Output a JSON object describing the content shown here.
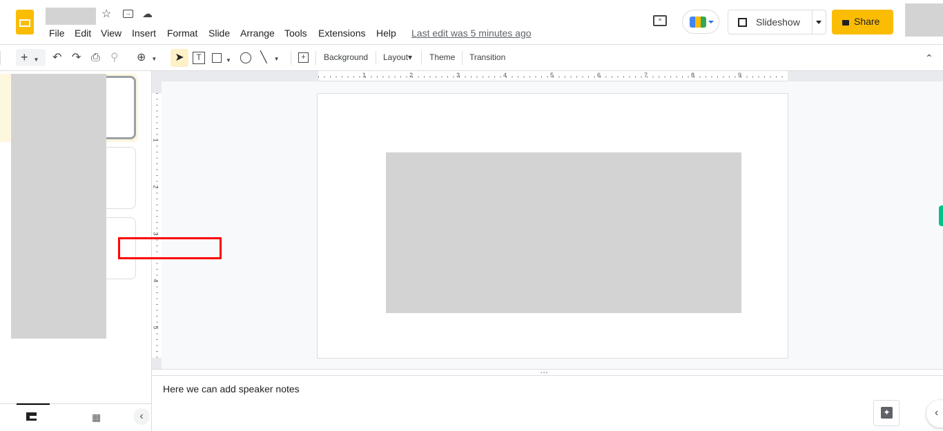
{
  "header": {
    "menu": [
      "File",
      "Edit",
      "View",
      "Insert",
      "Format",
      "Slide",
      "Arrange",
      "Tools",
      "Extensions",
      "Help"
    ],
    "last_edit": "Last edit was 5 minutes ago",
    "slideshow_label": "Slideshow",
    "share_label": "Share"
  },
  "toolbar": {
    "background": "Background",
    "layout": "Layout",
    "theme": "Theme",
    "transition": "Transition"
  },
  "ruler": {
    "h": [
      "1",
      "2",
      "3",
      "4",
      "5",
      "6",
      "7",
      "8",
      "9"
    ],
    "v": [
      "1",
      "2",
      "3",
      "4",
      "5"
    ]
  },
  "notes": {
    "text": "Here we can add speaker notes"
  },
  "colors": {
    "accent": "#fbbc04",
    "highlight": "#ff0000",
    "side_tab": "#00c38a"
  }
}
